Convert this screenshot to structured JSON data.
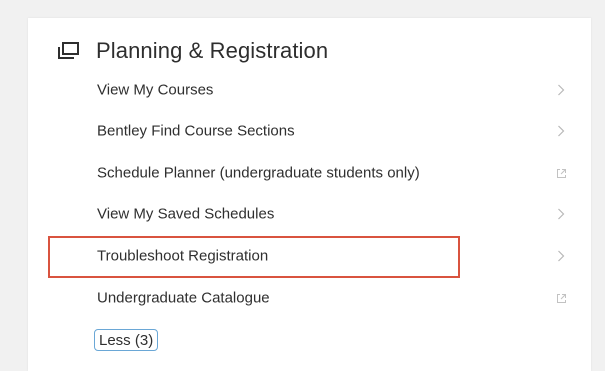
{
  "section": {
    "title": "Planning & Registration",
    "icon": "windows-icon"
  },
  "items": [
    {
      "label": "View My Courses",
      "icon": "chevron-right-icon"
    },
    {
      "label": "Bentley Find Course Sections",
      "icon": "chevron-right-icon"
    },
    {
      "label": "Schedule Planner (undergraduate students only)",
      "icon": "external-link-icon"
    },
    {
      "label": "View My Saved Schedules",
      "icon": "chevron-right-icon"
    },
    {
      "label": "Troubleshoot Registration",
      "icon": "chevron-right-icon"
    },
    {
      "label": "Undergraduate Catalogue",
      "icon": "external-link-icon"
    }
  ],
  "less_button": {
    "label": "Less (3)"
  },
  "colors": {
    "highlight": "#d9533f",
    "focus_outline": "#6aa7d6"
  }
}
